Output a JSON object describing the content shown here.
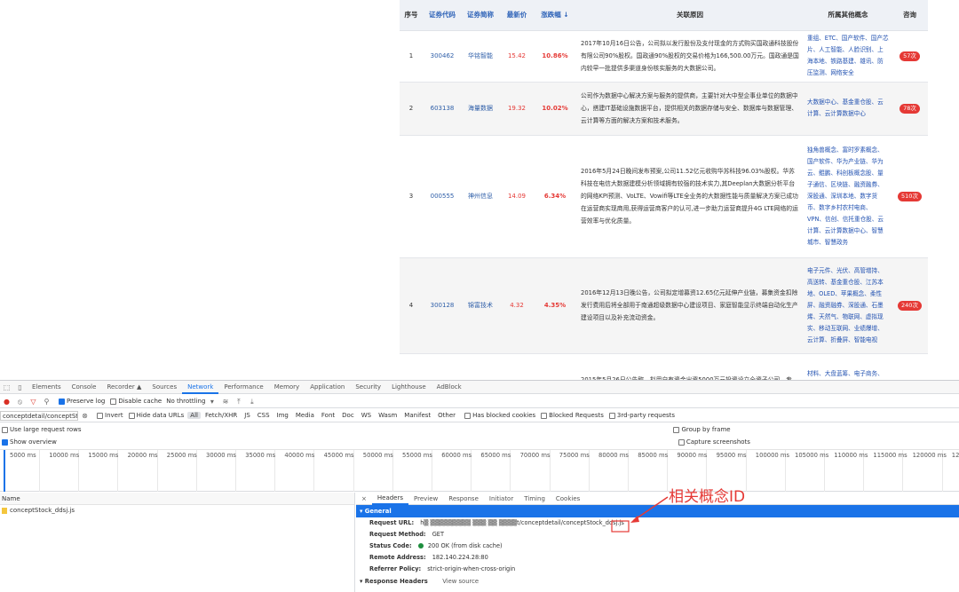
{
  "table": {
    "headers": [
      "序号",
      "证券代码",
      "证券简称",
      "最新价",
      "涨跌幅 ↓",
      "关联原因",
      "所属其他概念",
      "咨询"
    ],
    "rows": [
      {
        "no": "1",
        "code": "300462",
        "name": "华铭智能",
        "price": "15.42",
        "pct": "10.86%",
        "reason": "2017年10月16日公告，公司拟以发行股份及支付现金的方式购买国政通科技股份有限公司90%股权。国政通90%股权的交易价格为166,500.00万元。国政通是国内较早一批提供多渠道身份核实服务的大数据公司。",
        "concepts": "重组、ETC、国产软件、国产芯片、人工智能、人脸识别、上海本地、铁路基建、雄讯、防压监测、网络安全",
        "consult": "57次"
      },
      {
        "no": "2",
        "code": "603138",
        "name": "海量数据",
        "price": "19.32",
        "pct": "10.02%",
        "reason": "公司作为数据中心解决方案与服务的提供商，主要针对大中型企事业单位的数据中心，搭建IT基础设施数据平台，提供相关的数据存储与安全、数据库与数据管理、云计算等方面的解决方案和技术服务。",
        "concepts": "大数据中心、基金重仓股、云计算、云计算数据中心",
        "consult": "78次"
      },
      {
        "no": "3",
        "code": "000555",
        "name": "神州信息",
        "price": "14.09",
        "pct": "6.34%",
        "reason": "2016年5月24日晚间发布预案,公司11.52亿元收购华苏科技96.03%股权。华苏科技在电信大数据建模分析领域拥有较强的技术实力,其Deeplan大数据分析平台的网络KPI预测、VoLTE、Vowifi等LTE全业务的大数据性能与质量解决方案已成功在运营商实现商用,获得运营商客户的认可,进一步助力运营商提升4G LTE网络的运营效率与优化质量。",
        "concepts": "独角兽概念、富时罗素概念、国产软件、华为产业链、华为云、鲲鹏、科创板概念股、量子通信、区块链、融资融券、深股通、深圳本地、数字货币、数字乡村农村电商、VPN、信创、信托重仓股、云计算、云计算数据中心、智慧城市、智慧政务",
        "consult": "510次"
      },
      {
        "no": "4",
        "code": "300128",
        "name": "锦富技术",
        "price": "4.32",
        "pct": "4.35%",
        "reason": "2016年12月13日晚公告，公司拟定增募资12.65亿元延伸产业链，募集资金扣除发行费用后将全部用于南通超级数据中心建设项目、家庭智能显示终端自动化生产建设项目以及补充流动资金。",
        "concepts": "电子元件、光伏、高管增持、高送转、基金重仓股、江苏本地、OLED、苹果概念、柔性屏、融资融券、深股通、石墨烯、天然气、物联网、虚拟现实、移动互联网、业绩爆增、云计算、折叠屏、智能电视",
        "consult": "240次"
      },
      {
        "no": "",
        "code": "",
        "name": "",
        "price": "",
        "pct": "",
        "reason": "2015年5月26日公告称，拟用自有资金出资5000万元投资设立全资子公司，专",
        "concepts": "材料、大盘蓝筹、电子商务、富时罗素概念、海铁、汇金概",
        "consult": ""
      }
    ]
  },
  "devtools": {
    "tabs": [
      "Elements",
      "Console",
      "Recorder ▲",
      "Sources",
      "Network",
      "Performance",
      "Memory",
      "Application",
      "Security",
      "Lighthouse",
      "AdBlock"
    ],
    "active_tab": "Network",
    "preserve_log": "Preserve log",
    "disable_cache": "Disable cache",
    "throttling": "No throttling",
    "filter_value": "conceptdetail/conceptStock",
    "invert": "Invert",
    "hide_data_urls": "Hide data URLs",
    "filter_types": [
      "All",
      "Fetch/XHR",
      "JS",
      "CSS",
      "Img",
      "Media",
      "Font",
      "Doc",
      "WS",
      "Wasm",
      "Manifest",
      "Other"
    ],
    "has_blocked_cookies": "Has blocked cookies",
    "blocked_requests": "Blocked Requests",
    "third_party": "3rd-party requests",
    "large_rows": "Use large request rows",
    "show_overview": "Show overview",
    "group_by_frame": "Group by frame",
    "capture_screenshots": "Capture screenshots",
    "timeline_ticks": [
      "5000 ms",
      "10000 ms",
      "15000 ms",
      "20000 ms",
      "25000 ms",
      "30000 ms",
      "35000 ms",
      "40000 ms",
      "45000 ms",
      "50000 ms",
      "55000 ms",
      "60000 ms",
      "65000 ms",
      "70000 ms",
      "75000 ms",
      "80000 ms",
      "85000 ms",
      "90000 ms",
      "95000 ms",
      "100000 ms",
      "105000 ms",
      "110000 ms",
      "115000 ms",
      "120000 ms",
      "12500"
    ],
    "name_header": "Name",
    "request_name": "conceptStock_ddsj.js",
    "detail_tabs": [
      "×",
      "Headers",
      "Preview",
      "Response",
      "Initiator",
      "Timing",
      "Cookies"
    ],
    "general_label": "▾ General",
    "request_url_label": "Request URL:",
    "request_url_value": "h▒ ▒▒▒▒▒▒▒▒▒ ▒▒▒ ▒▒ ▒▒▒▒t/conceptdetail/conceptStock_ddsj.js",
    "request_method_label": "Request Method:",
    "request_method_value": "GET",
    "status_code_label": "Status Code:",
    "status_code_value": "200 OK (from disk cache)",
    "remote_address_label": "Remote Address:",
    "remote_address_value": "182.140.224.28:80",
    "referrer_policy_label": "Referrer Policy:",
    "referrer_policy_value": "strict-origin-when-cross-origin",
    "response_headers_label": "▾ Response Headers",
    "view_source": "View source"
  },
  "annotation": "相关概念ID",
  "colors": {
    "up": "#e53935",
    "link": "#2e5ea8",
    "accent": "#1a73e8"
  }
}
